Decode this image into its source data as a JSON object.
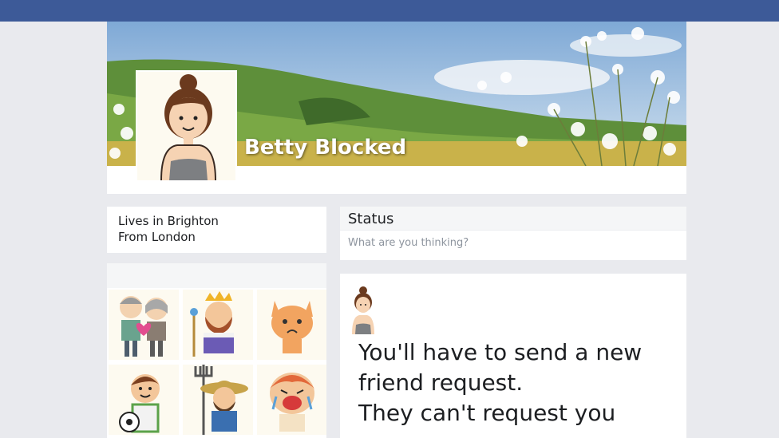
{
  "profile": {
    "name": "Betty Blocked"
  },
  "about": {
    "lives_in": "Lives in Brighton",
    "from": "From London"
  },
  "status": {
    "heading": "Status",
    "placeholder": "What are you thinking?"
  },
  "post": {
    "line1": "You'll have to send a new",
    "line2": "friend request.",
    "line3": "They can't request you"
  },
  "friends": {
    "tiles": [
      "elderly-couple-icon",
      "king-icon",
      "cat-icon",
      "boy-football-icon",
      "farmer-icon",
      "crying-baby-icon"
    ]
  },
  "colors": {
    "topbar": "#3d5a98",
    "background": "#e9eaee"
  }
}
